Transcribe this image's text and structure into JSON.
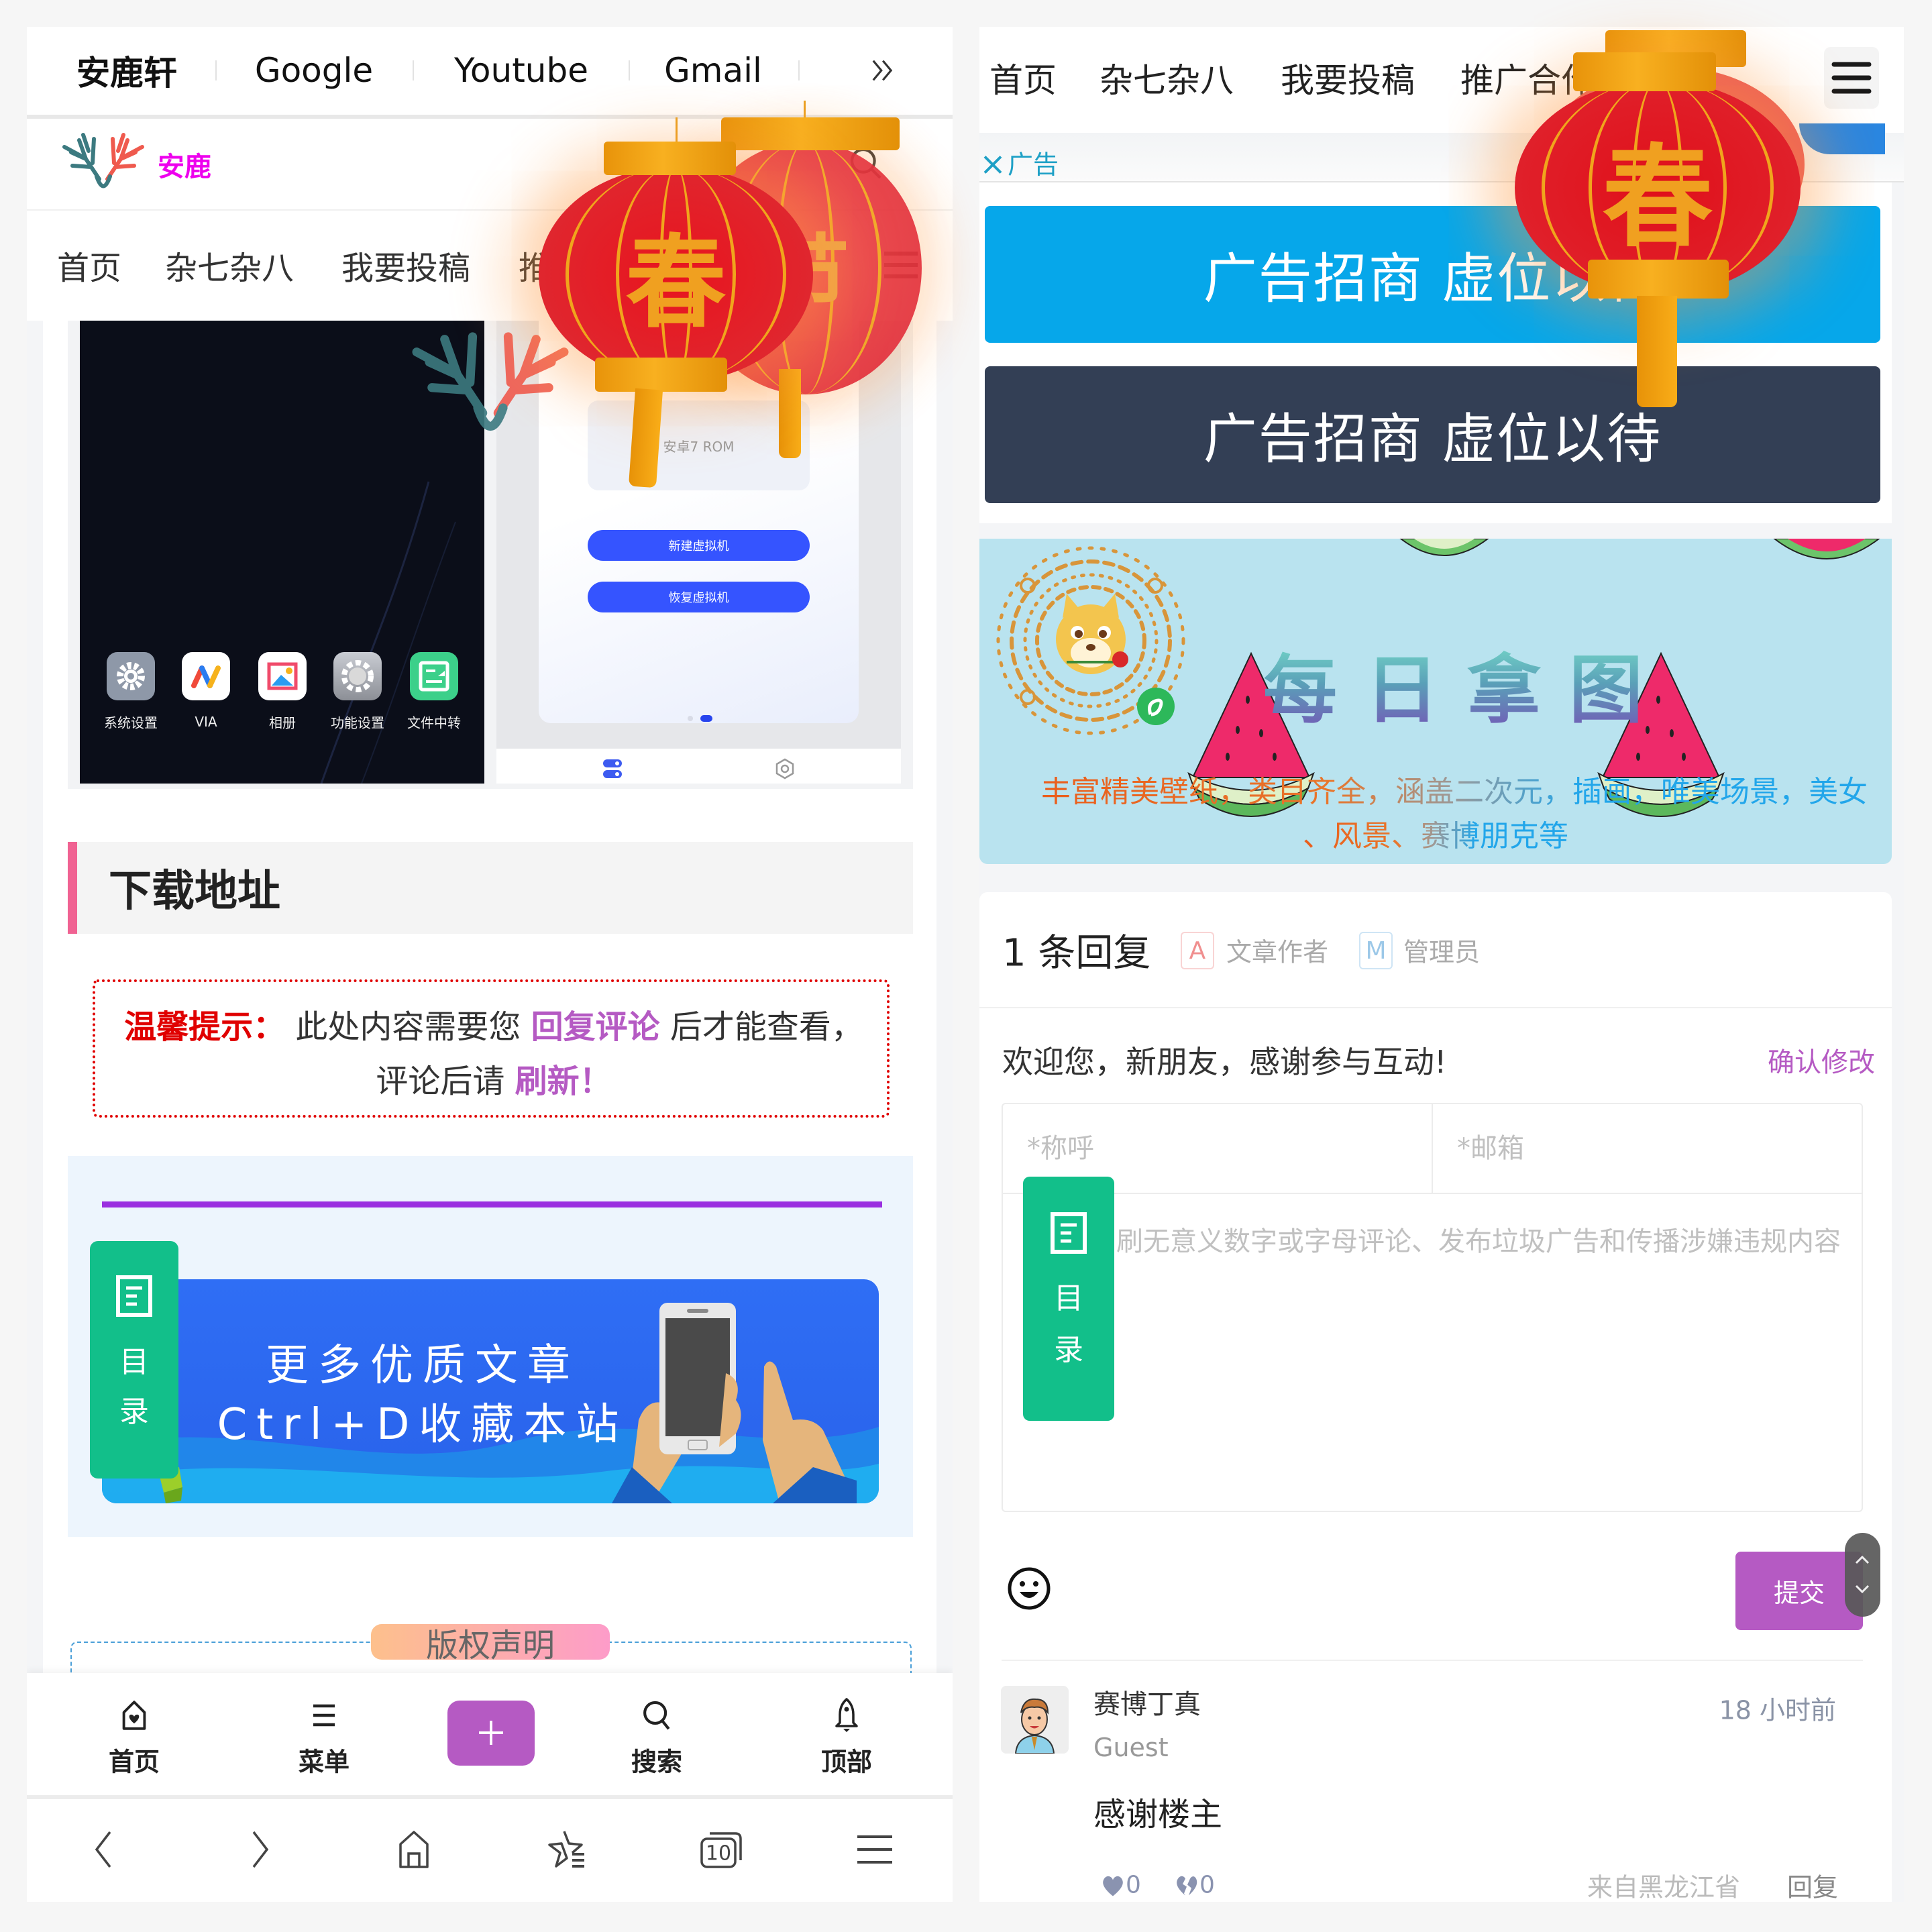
{
  "colors": {
    "accent_purple": "#b55ac3",
    "toc_green": "#12bf8a",
    "ad_blue": "#06a7ea",
    "ad_dark": "#333f55",
    "notice_red": "#e00000",
    "heading_bar_pink": "#f06292",
    "divider_purple": "#9a2fe0"
  },
  "left": {
    "bookmarks": {
      "items": [
        "安鹿轩",
        "Google",
        "Youtube",
        "Gmail"
      ],
      "more_icon": "double-chevron-right-icon"
    },
    "site_header": {
      "logo_text": "安鹿",
      "search_icon": "search-icon"
    },
    "nav": [
      "首页",
      "杂七杂八",
      "我要投稿",
      "推广合作"
    ],
    "article_image": {
      "apps": [
        "系统设置",
        "VIA",
        "相册",
        "功能设置",
        "文件中转"
      ],
      "rom_card": "安卓7 ROM",
      "buttons": [
        "新建虚拟机",
        "恢复虚拟机"
      ]
    },
    "section_heading": "下载地址",
    "notice": {
      "label": "温馨提示：",
      "text_1": "此处内容需要您",
      "link_1": "回复评论",
      "text_2": "后才能查看，",
      "text_3": "评论后请",
      "link_2": "刷新！"
    },
    "toc": {
      "char_1": "目",
      "char_2": "录"
    },
    "promo_banner": {
      "line_1": "更多优质文章",
      "line_2": "Ctrl+D收藏本站"
    },
    "copyright_label": "版权声明",
    "tabbar": [
      {
        "label": "首页",
        "icon": "home-heart-icon"
      },
      {
        "label": "菜单",
        "icon": "menu-icon"
      },
      {
        "label": "",
        "icon": "plus-icon"
      },
      {
        "label": "搜索",
        "icon": "search-icon"
      },
      {
        "label": "顶部",
        "icon": "bell-icon"
      }
    ],
    "browser_toolbar": {
      "tab_count": "10",
      "icons": [
        "back-icon",
        "forward-icon",
        "home-icon",
        "bookmarks-icon",
        "tabs-icon",
        "menu-icon"
      ]
    }
  },
  "right": {
    "nav": [
      "首页",
      "杂七杂八",
      "我要投稿",
      "推广合作"
    ],
    "ad_close_label": "广告",
    "ads": [
      "广告招商 虚位以待",
      "广告招商 虚位以待"
    ],
    "wallpaper_banner": {
      "title": "每日拿图",
      "desc_line_1": "丰富精美壁纸，类目齐全，涵盖二次元，插画，唯美场景，美女",
      "desc_line_2": "、风景、赛博朋克等"
    },
    "comments": {
      "count_title": "1 条回复",
      "badges": [
        {
          "letter": "A",
          "label": "文章作者"
        },
        {
          "letter": "M",
          "label": "管理员"
        }
      ],
      "welcome": "欢迎您，新朋友，感谢参与互动!",
      "confirm_edit": "确认修改",
      "name_placeholder": "*称呼",
      "email_placeholder": "*邮箱",
      "content_placeholder": "刷无意义数字或字母评论、发布垃圾广告和传播涉嫌违规内容",
      "submit": "提交",
      "list": [
        {
          "author": "赛博丁真",
          "role": "Guest",
          "time": "18 小时前",
          "content": "感谢楼主",
          "likes": "0",
          "dislikes": "0",
          "location": "来自黑龙江省",
          "reply": "回复"
        }
      ]
    },
    "toc": {
      "char_1": "目",
      "char_2": "录"
    }
  },
  "decorations": {
    "lantern_chars": [
      "春",
      "节"
    ]
  }
}
